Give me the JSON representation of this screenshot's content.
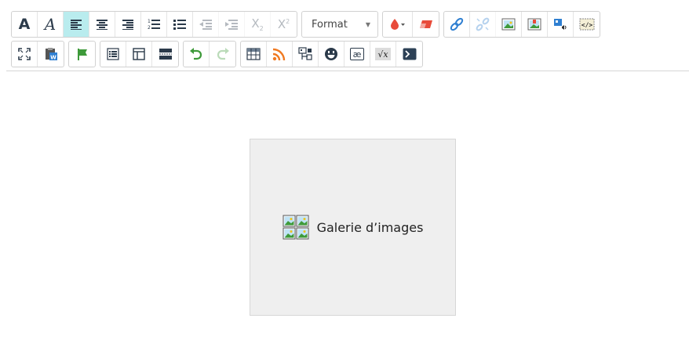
{
  "toolbar": {
    "row1": {
      "styles": {
        "bold": "A",
        "italic": "A"
      },
      "script": {
        "subscript_base": "X",
        "subscript_mark": "2",
        "superscript_base": "X",
        "superscript_mark": "2"
      },
      "format_select": {
        "value": "Format"
      }
    },
    "row2": {
      "special": {
        "special_char_label": "æ",
        "math_label": "√x"
      }
    },
    "colors": {
      "active_bg": "#b9ecee",
      "accent_blue": "#2f7fd1",
      "accent_green": "#3e9a3a",
      "accent_red": "#e84b3a",
      "accent_orange": "#f07a22"
    }
  },
  "content": {
    "gallery": {
      "label": "Galerie d’images"
    }
  }
}
